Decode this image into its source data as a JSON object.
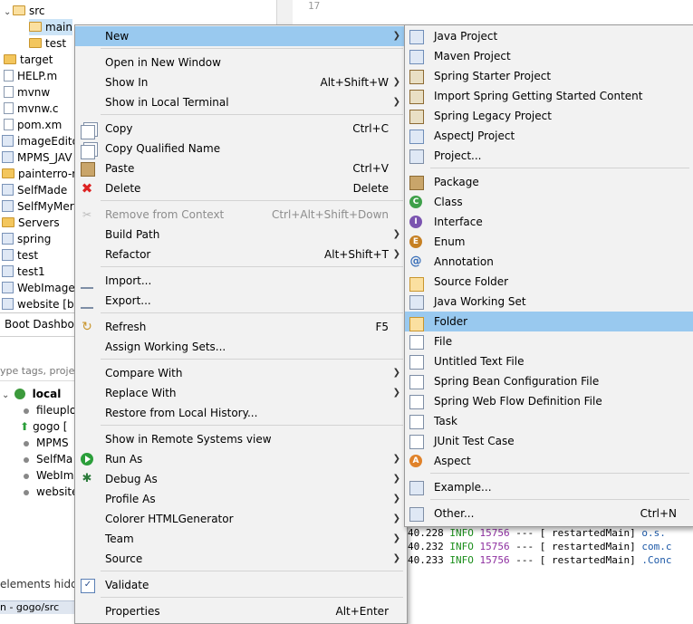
{
  "explorer": {
    "items": [
      {
        "label": "src",
        "kind": "folder-open",
        "indent": 1
      },
      {
        "label": "main",
        "kind": "folder-open",
        "indent": 2,
        "selected": true
      },
      {
        "label": "test",
        "kind": "folder",
        "indent": 2
      },
      {
        "label": "target",
        "kind": "folder",
        "indent": 1
      },
      {
        "label": "HELP.m",
        "kind": "file",
        "indent": 1
      },
      {
        "label": "mvnw",
        "kind": "file",
        "indent": 1
      },
      {
        "label": "mvnw.c",
        "kind": "file",
        "indent": 1
      },
      {
        "label": "pom.xm",
        "kind": "file",
        "indent": 1
      },
      {
        "label": "imageEdito",
        "kind": "project",
        "indent": 0
      },
      {
        "label": "MPMS_JAV",
        "kind": "project",
        "indent": 0
      },
      {
        "label": "painterro-r",
        "kind": "folder",
        "indent": 0
      },
      {
        "label": "SelfMade",
        "kind": "project",
        "indent": 0
      },
      {
        "label": "SelfMyMer",
        "kind": "project",
        "indent": 0
      },
      {
        "label": "Servers",
        "kind": "folder",
        "indent": 0
      },
      {
        "label": "spring",
        "kind": "project",
        "indent": 0
      },
      {
        "label": "test",
        "kind": "project",
        "indent": 0
      },
      {
        "label": "test1",
        "kind": "project",
        "indent": 0
      },
      {
        "label": "WebImage",
        "kind": "project",
        "indent": 0
      },
      {
        "label": "website [b",
        "kind": "project",
        "indent": 0
      }
    ],
    "gutter_line": "17"
  },
  "boot_dashboard": {
    "tab_label": "Boot Dashboa",
    "filter_placeholder": "ype tags, projec",
    "local_label": "local",
    "apps": [
      "fileuplo",
      "gogo [",
      "MPMS",
      "SelfMa",
      "WebIm",
      "website"
    ],
    "hidden_note": "elements hidde",
    "status_text": "n - gogo/src"
  },
  "console": {
    "lines": [
      {
        "time": "40.228",
        "level": "INFO",
        "pid": "15756",
        "sep": "---",
        "thread": "[  restartedMain]",
        "cls": "o.s."
      },
      {
        "time": "40.232",
        "level": "INFO",
        "pid": "15756",
        "sep": "---",
        "thread": "[  restartedMain]",
        "cls": "com.c"
      },
      {
        "time": "40.233",
        "level": "INFO",
        "pid": "15756",
        "sep": "---",
        "thread": "[  restartedMain]",
        "cls": ".Conc"
      }
    ]
  },
  "context_menu": {
    "items": [
      {
        "label": "New",
        "submenu": true,
        "highlighted": true
      },
      {
        "sep": true
      },
      {
        "label": "Open in New Window"
      },
      {
        "label": "Show In",
        "shortcut": "Alt+Shift+W",
        "submenu": true
      },
      {
        "label": "Show in Local Terminal",
        "submenu": true
      },
      {
        "sep": true
      },
      {
        "label": "Copy",
        "shortcut": "Ctrl+C",
        "icon": "copy-icon"
      },
      {
        "label": "Copy Qualified Name",
        "icon": "copy-icon"
      },
      {
        "label": "Paste",
        "shortcut": "Ctrl+V",
        "icon": "paste-icon"
      },
      {
        "label": "Delete",
        "shortcut": "Delete",
        "icon": "delete-icon"
      },
      {
        "sep": true
      },
      {
        "label": "Remove from Context",
        "shortcut": "Ctrl+Alt+Shift+Down",
        "icon": "remove-context-icon",
        "disabled": true
      },
      {
        "label": "Build Path",
        "submenu": true
      },
      {
        "label": "Refactor",
        "shortcut": "Alt+Shift+T",
        "submenu": true
      },
      {
        "sep": true
      },
      {
        "label": "Import...",
        "icon": "import-icon"
      },
      {
        "label": "Export...",
        "icon": "export-icon"
      },
      {
        "sep": true
      },
      {
        "label": "Refresh",
        "shortcut": "F5",
        "icon": "refresh-icon"
      },
      {
        "label": "Assign Working Sets..."
      },
      {
        "sep": true
      },
      {
        "label": "Compare With",
        "submenu": true
      },
      {
        "label": "Replace With",
        "submenu": true
      },
      {
        "label": "Restore from Local History..."
      },
      {
        "sep": true
      },
      {
        "label": "Show in Remote Systems view"
      },
      {
        "label": "Run As",
        "submenu": true,
        "icon": "run-icon"
      },
      {
        "label": "Debug As",
        "submenu": true,
        "icon": "debug-icon"
      },
      {
        "label": "Profile As",
        "submenu": true
      },
      {
        "label": "Colorer HTMLGenerator",
        "submenu": true
      },
      {
        "label": "Team",
        "submenu": true
      },
      {
        "label": "Source",
        "submenu": true
      },
      {
        "sep": true
      },
      {
        "label": "Validate",
        "icon": "validate-check-icon"
      },
      {
        "sep": true
      },
      {
        "label": "Properties",
        "shortcut": "Alt+Enter"
      }
    ]
  },
  "new_submenu": {
    "items": [
      {
        "label": "Java Project",
        "icon": "java-project-icon"
      },
      {
        "label": "Maven Project",
        "icon": "maven-project-icon"
      },
      {
        "label": "Spring Starter Project",
        "icon": "spring-starter-icon"
      },
      {
        "label": "Import Spring Getting Started Content",
        "icon": "spring-import-icon"
      },
      {
        "label": "Spring Legacy Project",
        "icon": "spring-legacy-icon"
      },
      {
        "label": "AspectJ Project",
        "icon": "aspectj-project-icon"
      },
      {
        "label": "Project...",
        "icon": "project-icon"
      },
      {
        "sep": true
      },
      {
        "label": "Package",
        "icon": "package-icon"
      },
      {
        "label": "Class",
        "icon": "class-icon"
      },
      {
        "label": "Interface",
        "icon": "interface-icon"
      },
      {
        "label": "Enum",
        "icon": "enum-icon"
      },
      {
        "label": "Annotation",
        "icon": "annotation-icon"
      },
      {
        "label": "Source Folder",
        "icon": "source-folder-icon"
      },
      {
        "label": "Java Working Set",
        "icon": "working-set-icon"
      },
      {
        "label": "Folder",
        "icon": "folder-icon",
        "highlighted": true
      },
      {
        "label": "File",
        "icon": "file-icon"
      },
      {
        "label": "Untitled Text File",
        "icon": "text-file-icon"
      },
      {
        "label": "Spring Bean Configuration File",
        "icon": "spring-bean-icon"
      },
      {
        "label": "Spring Web Flow Definition File",
        "icon": "spring-webflow-icon"
      },
      {
        "label": "Task",
        "icon": "task-icon"
      },
      {
        "label": "JUnit Test Case",
        "icon": "junit-icon"
      },
      {
        "label": "Aspect",
        "icon": "aspect-icon"
      },
      {
        "sep": true
      },
      {
        "label": "Example...",
        "icon": "example-icon"
      },
      {
        "sep": true
      },
      {
        "label": "Other...",
        "shortcut": "Ctrl+N",
        "icon": "other-icon"
      }
    ]
  }
}
